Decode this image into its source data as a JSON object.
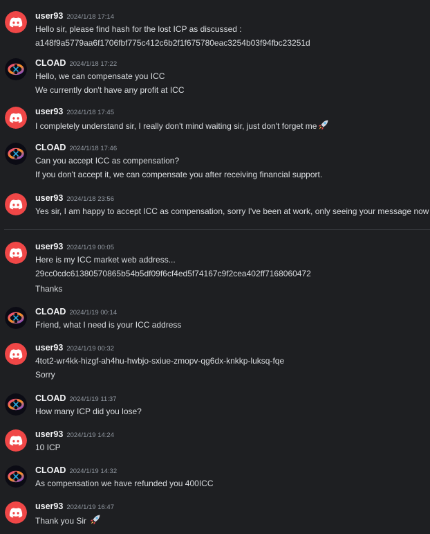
{
  "colors": {
    "background": "#1e1f22",
    "discord_avatar": "#f04747",
    "name": "#f2f3f5",
    "timestamp": "#949ba4",
    "text": "#dbdee1"
  },
  "messages": [
    {
      "author": "user93",
      "avatar": "discord-logo-icon",
      "time": "2024/1/18 17:14",
      "lines": [
        "Hello sir, please find hash for the lost ICP as discussed :",
        "a148f9a5779aa6f1706fbf775c412c6b2f1f675780eac3254b03f94fbc23251d"
      ]
    },
    {
      "author": "CLOAD",
      "avatar": "cload-logo-icon",
      "time": "2024/1/18 17:22",
      "lines": [
        "Hello, we can compensate you ICC",
        "We currently don't have any profit at ICC"
      ]
    },
    {
      "author": "user93",
      "avatar": "discord-logo-icon",
      "time": "2024/1/18 17:45",
      "lines": [
        "I completely understand sir, I really don't mind waiting sir, just don't forget me"
      ]
    },
    {
      "author": "CLOAD",
      "avatar": "cload-logo-icon",
      "time": "2024/1/18 17:46",
      "lines": [
        "Can you accept ICC as compensation?",
        "If you don't accept it, we can compensate you after receiving financial support."
      ]
    },
    {
      "author": "user93",
      "avatar": "discord-logo-icon",
      "time": "2024/1/18 23:56",
      "lines": [
        "Yes sir, I am happy to accept ICC as compensation, sorry I've been at work, only seeing your message now"
      ]
    },
    {
      "author": "user93",
      "avatar": "discord-logo-icon",
      "time": "2024/1/19 00:05",
      "lines": [
        "Here is my ICC market web address...",
        "29cc0cdc61380570865b54b5df09f6cf4ed5f74167c9f2cea402ff7168060472",
        "Thanks"
      ]
    },
    {
      "author": "CLOAD",
      "avatar": "cload-logo-icon",
      "time": "2024/1/19 00:14",
      "lines": [
        "Friend, what I need is your ICC address"
      ]
    },
    {
      "author": "user93",
      "avatar": "discord-logo-icon",
      "time": "2024/1/19 00:32",
      "lines": [
        "4tot2-wr4kk-hizgf-ah4hu-hwbjo-sxiue-zmopv-qg6dx-knkkp-luksq-fqe",
        "Sorry"
      ]
    },
    {
      "author": "CLOAD",
      "avatar": "cload-logo-icon",
      "time": "2024/1/19 11:37",
      "lines": [
        "How many ICP did you lose?"
      ]
    },
    {
      "author": "user93",
      "avatar": "discord-logo-icon",
      "time": "2024/1/19 14:24",
      "lines": [
        "10 ICP"
      ]
    },
    {
      "author": "CLOAD",
      "avatar": "cload-logo-icon",
      "time": "2024/1/19 14:32",
      "lines": [
        "As compensation we have refunded you 400ICC"
      ]
    },
    {
      "author": "user93",
      "avatar": "discord-logo-icon",
      "time": "2024/1/19 16:47",
      "lines": [
        "Thank you Sir "
      ]
    }
  ]
}
